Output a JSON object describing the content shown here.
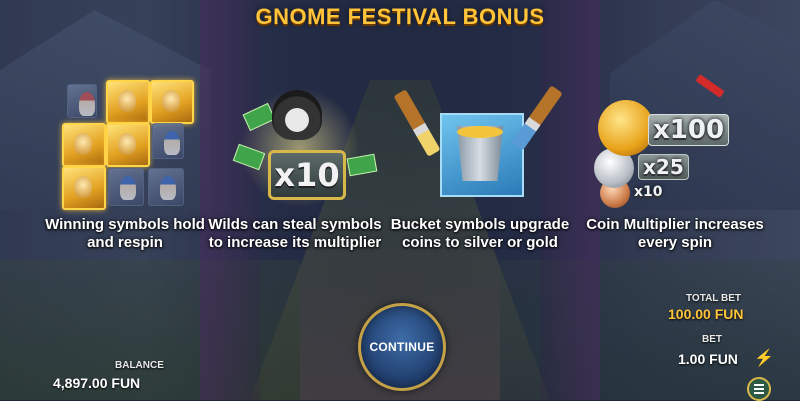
{
  "title": "GNOME FESTIVAL BONUS",
  "features": [
    {
      "icon": "gnome-symbols-grid-icon",
      "text": "Winning symbols hold and respin"
    },
    {
      "icon": "raccoon-wild-icon",
      "badge": "x10",
      "text": "Wilds can steal symbols to increase its multiplier"
    },
    {
      "icon": "paint-bucket-icon",
      "text": "Bucket symbols upgrade coins to silver or gold"
    },
    {
      "icon": "coin-multiplier-icon",
      "multipliers": [
        "x100",
        "x25",
        "x10"
      ],
      "text": "Coin Multiplier increases every spin"
    }
  ],
  "continue_label": "CONTINUE",
  "balance": {
    "label": "BALANCE",
    "value": "4,897.00 FUN"
  },
  "total_bet": {
    "label": "TOTAL BET",
    "value": "100.00 FUN"
  },
  "bet": {
    "label": "BET",
    "value": "1.00 FUN"
  },
  "icons": {
    "turbo": "lightning-off-icon",
    "menu": "hamburger-menu-icon"
  },
  "colors": {
    "title": "#ffc43a",
    "accent_border": "#c4a046",
    "button": "#1f3c6a"
  }
}
